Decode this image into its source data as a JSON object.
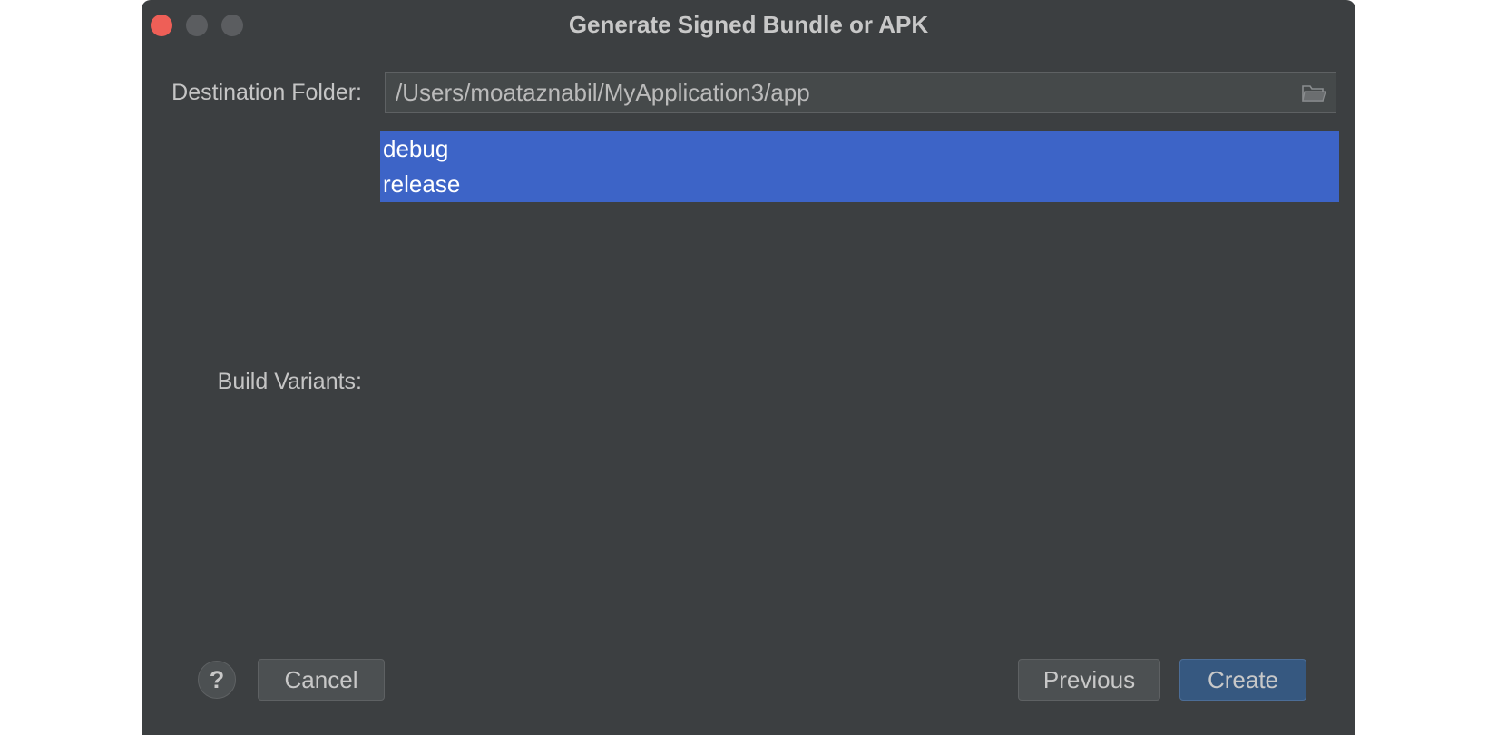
{
  "window": {
    "title": "Generate Signed Bundle or APK"
  },
  "form": {
    "destination_label": "Destination Folder:",
    "destination_value": "/Users/moataznabil/MyApplication3/app",
    "variants_label": "Build Variants:",
    "variants": [
      "debug",
      "release"
    ],
    "selected_variants": [
      "debug",
      "release"
    ]
  },
  "footer": {
    "help_label": "?",
    "cancel_label": "Cancel",
    "previous_label": "Previous",
    "create_label": "Create"
  },
  "colors": {
    "dialog_bg": "#3c3f41",
    "selection": "#3d64c7",
    "default_button": "#365880",
    "close_button": "#ee5f57"
  },
  "icons": {
    "folder": "folder-icon"
  }
}
